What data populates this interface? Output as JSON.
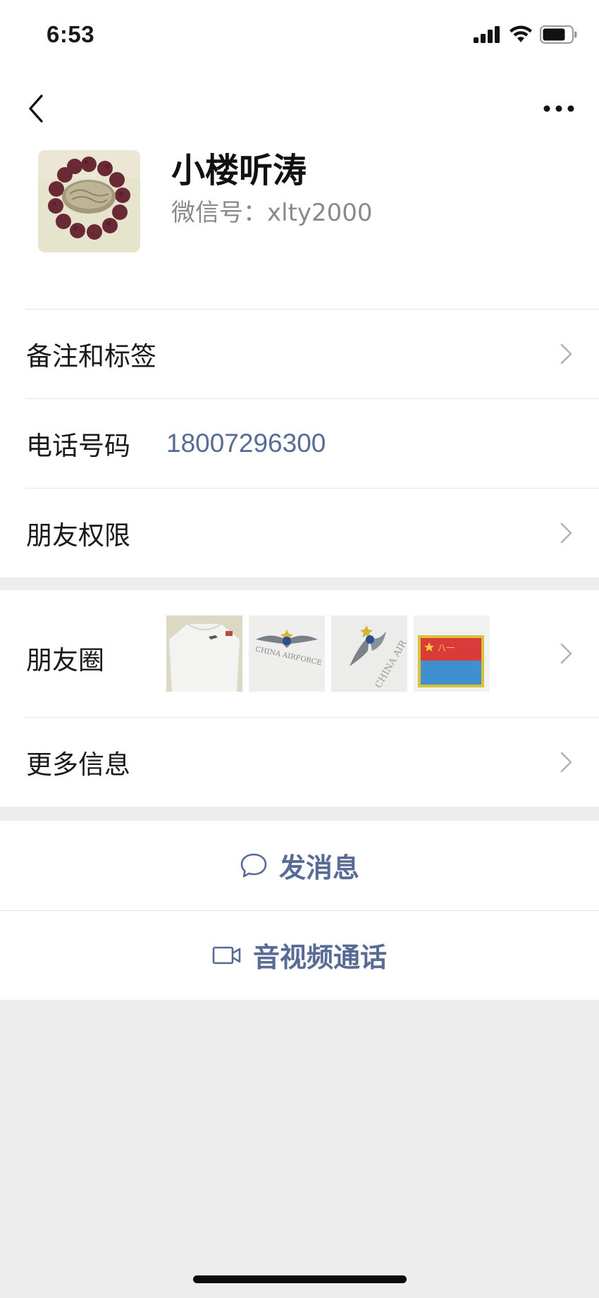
{
  "status_bar": {
    "time": "6:53",
    "icons": [
      "signal-icon",
      "wifi-icon",
      "battery-icon"
    ]
  },
  "nav": {
    "back_icon": "chevron-left-icon",
    "more_icon": "more-dots-icon"
  },
  "profile": {
    "name": "小楼听涛",
    "wechat_id": "微信号：xlty2000"
  },
  "rows": {
    "remarks_label": "备注和标签",
    "phone_label": "电话号码",
    "phone_value": "18007296300",
    "privacy_label": "朋友权限",
    "moments_label": "朋友圈",
    "more_info_label": "更多信息"
  },
  "actions": {
    "message_label": "发消息",
    "message_icon": "chat-bubble-icon",
    "call_label": "音视频通话",
    "call_icon": "video-camera-icon"
  },
  "colors": {
    "link_blue": "#576b95",
    "background": "#ededed",
    "surface": "#ffffff"
  }
}
